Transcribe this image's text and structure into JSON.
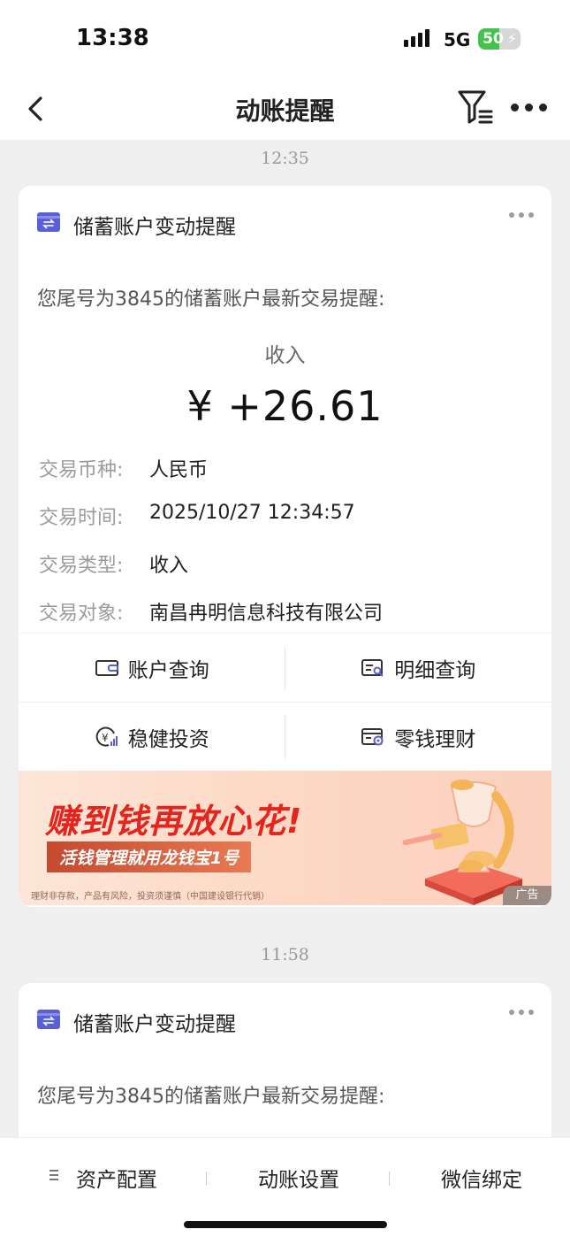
{
  "status_bar": {
    "time": "13:38",
    "network": "5G",
    "battery": "50",
    "battery_level": 0.5
  },
  "nav": {
    "title": "动账提醒",
    "back_icon": "chevron-left-icon",
    "filter_icon": "filter-icon",
    "more_icon": "more-horizontal-icon"
  },
  "notifications": [
    {
      "timestamp": "12:35",
      "title": "储蓄账户变动提醒",
      "intro": "您尾号为3845的储蓄账户最新交易提醒:",
      "amount_label": "收入",
      "amount": "¥ +26.61",
      "details": [
        {
          "label": "交易币种:",
          "value": "人民币"
        },
        {
          "label": "交易时间:",
          "value": "2025/10/27 12:34:57"
        },
        {
          "label": "交易类型:",
          "value": "收入"
        },
        {
          "label": "交易对象:",
          "value": "南昌冉明信息科技有限公司"
        }
      ],
      "actions": [
        "账户查询",
        "明细查询",
        "稳健投资",
        "零钱理财"
      ],
      "banner": {
        "headline": "赚到钱再放心花!",
        "subline": "活钱管理就用龙钱宝1号",
        "disclaimer": "理财非存款，产品有风险，投资须谨慎（中国建设银行代销）",
        "ad_tag": "广告"
      }
    },
    {
      "timestamp": "11:58",
      "title": "储蓄账户变动提醒",
      "intro": "您尾号为3845的储蓄账户最新交易提醒:"
    }
  ],
  "tabbar": {
    "items": [
      "资产配置",
      "动账设置",
      "微信绑定"
    ]
  },
  "colors": {
    "accent": "#5b5fd6",
    "ad_red": "#e3251e",
    "background": "#efefef"
  }
}
